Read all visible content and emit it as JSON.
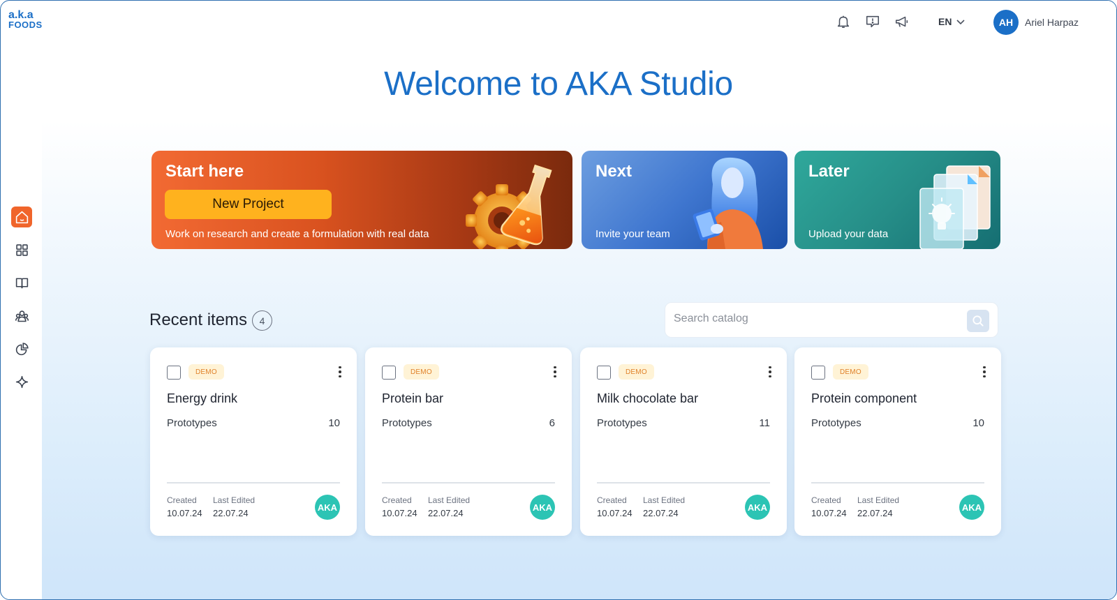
{
  "logo": {
    "line1": "a.k.a",
    "line2": "FOODS"
  },
  "sidebar": {
    "items": [
      {
        "name": "home",
        "icon": "home-icon",
        "active": true
      },
      {
        "name": "grid",
        "icon": "grid-icon"
      },
      {
        "name": "book",
        "icon": "book-icon"
      },
      {
        "name": "users",
        "icon": "users-icon"
      },
      {
        "name": "chart",
        "icon": "pie-chart-icon"
      },
      {
        "name": "sparkle",
        "icon": "sparkle-icon"
      }
    ]
  },
  "header": {
    "icons": [
      "bell-icon",
      "message-alert-icon",
      "megaphone-icon"
    ],
    "language": "EN",
    "user_initials": "AH",
    "user_name": "Ariel Harpaz"
  },
  "title": "Welcome to AKA Studio",
  "banners": {
    "start": {
      "title": "Start here",
      "button": "New Project",
      "subtitle": "Work on research and create a formulation with real data"
    },
    "next": {
      "title": "Next",
      "subtitle": "Invite your team"
    },
    "later": {
      "title": "Later",
      "subtitle": "Upload your data"
    }
  },
  "recent": {
    "title": "Recent items",
    "count": "4",
    "search_placeholder": "Search catalog"
  },
  "cards": [
    {
      "badge": "DEMO",
      "name": "Energy drink",
      "proto_label": "Prototypes",
      "proto_count": "10",
      "created_label": "Created",
      "created": "10.07.24",
      "edited_label": "Last Edited",
      "edited": "22.07.24",
      "owner": "AKA"
    },
    {
      "badge": "DEMO",
      "name": "Protein bar",
      "proto_label": "Prototypes",
      "proto_count": "6",
      "created_label": "Created",
      "created": "10.07.24",
      "edited_label": "Last Edited",
      "edited": "22.07.24",
      "owner": "AKA"
    },
    {
      "badge": "DEMO",
      "name": "Milk chocolate bar",
      "proto_label": "Prototypes",
      "proto_count": "11",
      "created_label": "Created",
      "created": "10.07.24",
      "edited_label": "Last Edited",
      "edited": "22.07.24",
      "owner": "AKA"
    },
    {
      "badge": "DEMO",
      "name": "Protein component",
      "proto_label": "Prototypes",
      "proto_count": "10",
      "created_label": "Created",
      "created": "10.07.24",
      "edited_label": "Last Edited",
      "edited": "22.07.24",
      "owner": "AKA"
    }
  ],
  "colors": {
    "brand": "#1b6fc7",
    "accent": "#f0652b",
    "button": "#ffb21e",
    "owner_badge": "#2cc4b4"
  }
}
